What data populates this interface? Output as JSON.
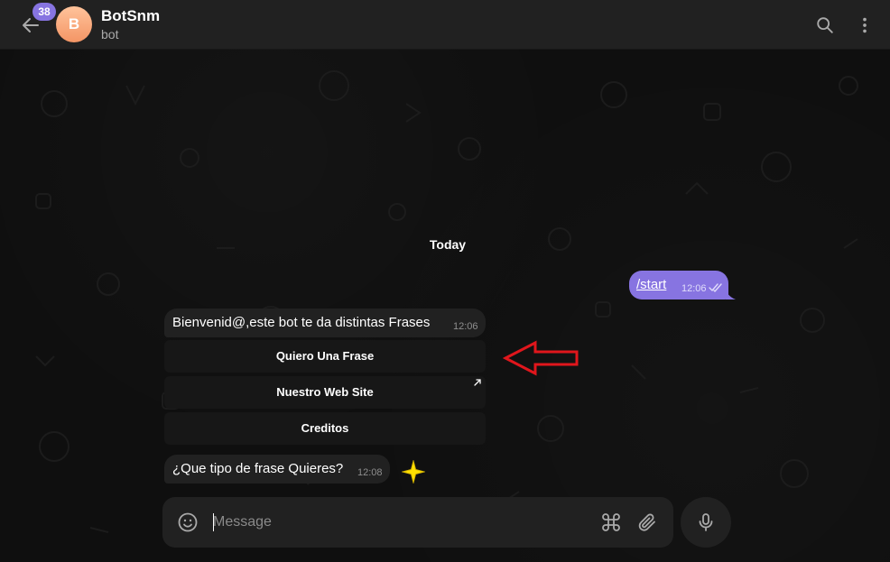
{
  "header": {
    "unread_count": "38",
    "avatar_letter": "B",
    "title": "BotSnm",
    "subtitle": "bot"
  },
  "chat": {
    "date_separator": "Today",
    "outgoing": {
      "text": "/start",
      "time": "12:06"
    },
    "welcome": {
      "text": "Bienvenid@,este bot te da distintas Frases",
      "time": "12:06"
    },
    "keyboard": [
      {
        "label": "Quiero Una Frase",
        "is_link": false
      },
      {
        "label": "Nuestro Web Site",
        "is_link": true
      },
      {
        "label": "Creditos",
        "is_link": false
      }
    ],
    "question": {
      "text": "¿Que tipo de frase Quieres?",
      "time": "12:08"
    }
  },
  "composer": {
    "placeholder": "Message"
  },
  "colors": {
    "accent": "#8774e1",
    "bubble_in": "#212121",
    "annotation_arrow": "#e0161c",
    "annotation_star": "#ffe000"
  }
}
